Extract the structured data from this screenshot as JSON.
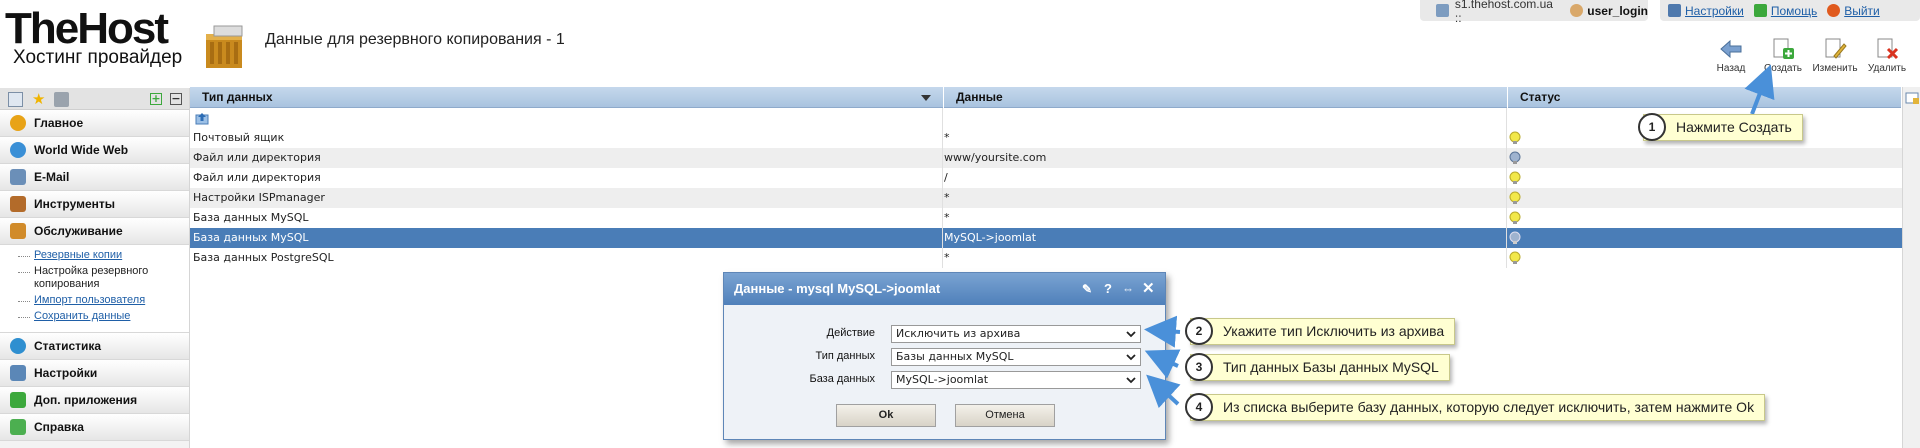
{
  "header": {
    "logo_main": "TheHost",
    "logo_sub": "Хостинг провайдер",
    "page_title": "Данные для резервного копирования - 1"
  },
  "userbar": {
    "server": "s1.thehost.com.ua ::",
    "user": "user_login",
    "settings": "Настройки",
    "help": "Помощь",
    "logout": "Выйти"
  },
  "toolbar": {
    "back": "Назад",
    "create": "Создать",
    "edit": "Изменить",
    "delete": "Удалить"
  },
  "sidebar": {
    "items": [
      {
        "label": "Главное",
        "icon": "home-icon",
        "color": "#e8a317"
      },
      {
        "label": "World Wide Web",
        "icon": "globe-icon",
        "color": "#3a8fd6"
      },
      {
        "label": "E-Mail",
        "icon": "mail-icon",
        "color": "#6b8fb8"
      },
      {
        "label": "Инструменты",
        "icon": "tools-icon",
        "color": "#b36b2a"
      },
      {
        "label": "Обслуживание",
        "icon": "service-icon",
        "color": "#d18b2a"
      },
      {
        "label": "Статистика",
        "icon": "stats-icon",
        "color": "#2f8fd0"
      },
      {
        "label": "Настройки",
        "icon": "settings-icon",
        "color": "#5b87b7"
      },
      {
        "label": "Доп. приложения",
        "icon": "plus-icon",
        "color": "#3ca83c"
      },
      {
        "label": "Справка",
        "icon": "help-icon",
        "color": "#4caf50"
      }
    ],
    "subitems": [
      {
        "label": "Резервные копии"
      },
      {
        "label": "Настройка резервного копирования"
      },
      {
        "label": "Импорт пользователя"
      },
      {
        "label": "Сохранить данные"
      }
    ]
  },
  "table": {
    "headers": [
      "Тип данных",
      "Данные",
      "Статус"
    ],
    "rows": [
      {
        "type": "Почтовый ящик",
        "data": "*"
      },
      {
        "type": "Файл или директория",
        "data": "www/yoursite.com"
      },
      {
        "type": "Файл или директория",
        "data": "/"
      },
      {
        "type": "Настройки ISPmanager",
        "data": "*"
      },
      {
        "type": "База данных MySQL",
        "data": "*"
      },
      {
        "type": "База данных MySQL",
        "data": "MySQL->joomlat"
      },
      {
        "type": "База данных PostgreSQL",
        "data": "*"
      }
    ]
  },
  "dialog": {
    "title": "Данные - mysql MySQL->joomlat",
    "fields": [
      {
        "label": "Действие",
        "value": "Исключить из архива"
      },
      {
        "label": "Тип данных",
        "value": "Базы данных MySQL"
      },
      {
        "label": "База данных",
        "value": "MySQL->joomlat"
      }
    ],
    "ok": "Ok",
    "cancel": "Отмена"
  },
  "callouts": [
    {
      "num": "1",
      "text": "Нажмите Создать"
    },
    {
      "num": "2",
      "text": "Укажите тип Исключить из архива"
    },
    {
      "num": "3",
      "text": "Тип данных Базы данных MySQL"
    },
    {
      "num": "4",
      "text": "Из списка выберите базу данных, которую следует исключить, затем нажмите Ok"
    }
  ],
  "colors": {
    "selected_row": "#4a7db7",
    "header_bg": "#a9c3df",
    "callout_bg": "#ffffd2",
    "link": "#1f5fa7"
  }
}
